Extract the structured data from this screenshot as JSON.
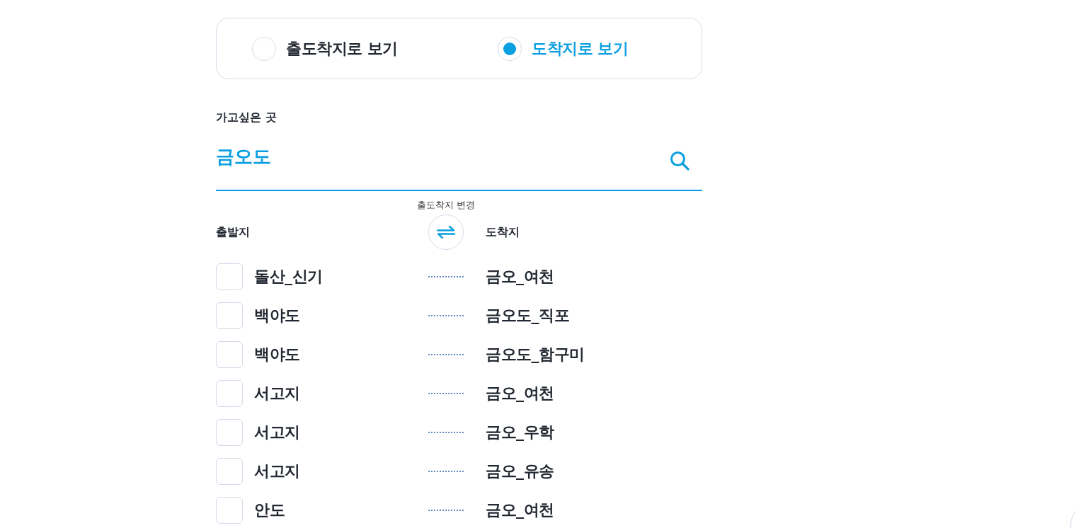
{
  "view_mode": {
    "options": [
      {
        "label": "출도착지로 보기",
        "selected": false
      },
      {
        "label": "도착지로 보기",
        "selected": true
      }
    ]
  },
  "search": {
    "label": "가고싶은 곳",
    "value": "금오도"
  },
  "swap": {
    "caption": "출도착지 변경"
  },
  "columns": {
    "departure": "출발지",
    "arrival": "도착지"
  },
  "routes": [
    {
      "departure": "돌산_신기",
      "arrival": "금오_여천",
      "checked": false
    },
    {
      "departure": "백야도",
      "arrival": "금오도_직포",
      "checked": false
    },
    {
      "departure": "백야도",
      "arrival": "금오도_함구미",
      "checked": false
    },
    {
      "departure": "서고지",
      "arrival": "금오_여천",
      "checked": false
    },
    {
      "departure": "서고지",
      "arrival": "금오_우학",
      "checked": false
    },
    {
      "departure": "서고지",
      "arrival": "금오_유송",
      "checked": false
    },
    {
      "departure": "안도",
      "arrival": "금오_여천",
      "checked": false
    }
  ]
}
